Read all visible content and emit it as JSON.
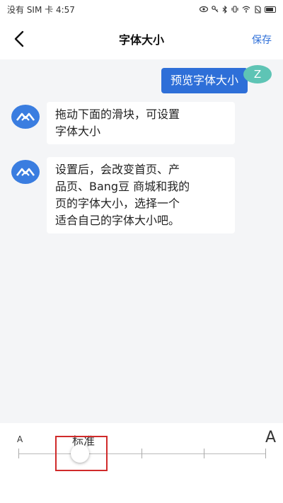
{
  "status_bar": {
    "carrier_time": "没有 SIM 卡 4:57"
  },
  "nav": {
    "title": "字体大小",
    "save_label": "保存"
  },
  "chat": {
    "user_message": "预览字体大小",
    "user_avatar_letter": "Z",
    "bot_messages": [
      {
        "lines": [
          "拖动下面的滑块，可设置",
          "字体大小"
        ]
      },
      {
        "lines": [
          "设置后，会改变首页、产",
          "品页、Bang豆 商城和我的",
          "页的字体大小，选择一个",
          "适合自己的字体大小吧。"
        ]
      }
    ]
  },
  "font_slider": {
    "small_label": "A",
    "large_label": "A",
    "current_level_label": "标准",
    "positions": 5,
    "selected_index": 1
  },
  "colors": {
    "accent": "#2e6fd8",
    "user_avatar": "#5ec4b5",
    "bot_avatar": "#3a7de0",
    "chat_background": "#f4f5f7",
    "highlight": "#d02a2a"
  }
}
